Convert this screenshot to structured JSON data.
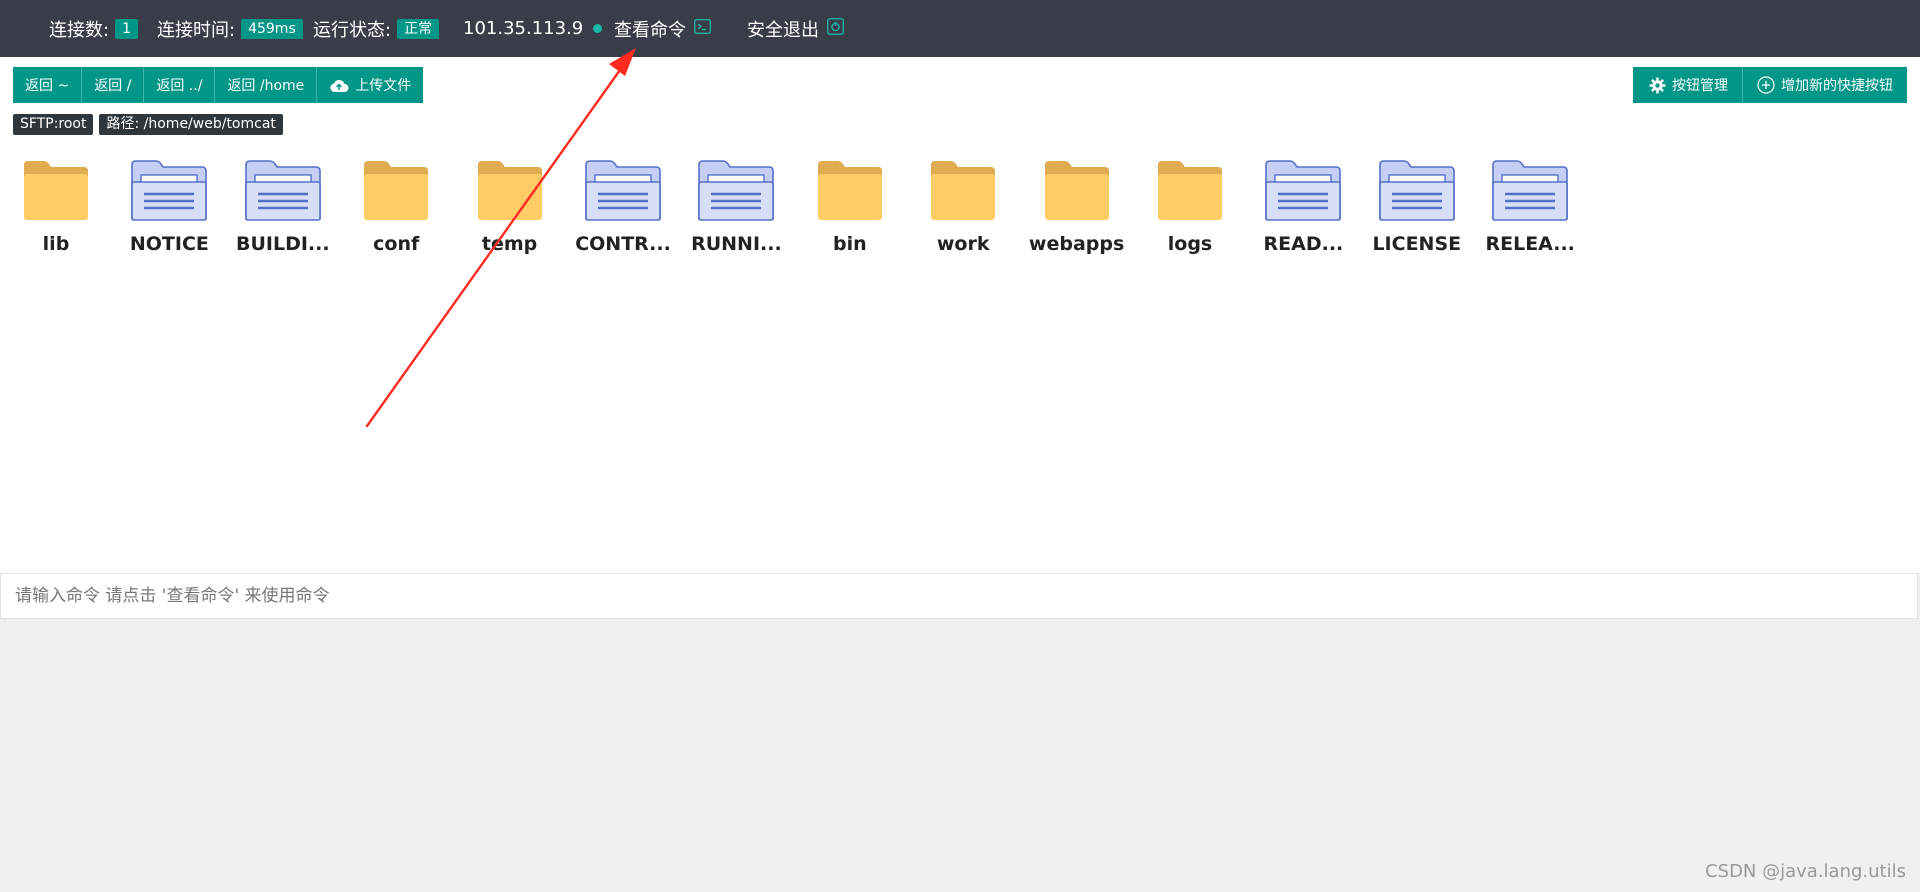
{
  "topbar": {
    "connections_label": "连接数:",
    "connections_value": "1",
    "time_label": "连接时间:",
    "time_value": "459ms",
    "status_label": "运行状态:",
    "status_value": "正常",
    "host": "101.35.113.9",
    "view_commands": "查看命令",
    "logout": "安全退出"
  },
  "toolbar": {
    "back_buttons": [
      "返回 ~",
      "返回 /",
      "返回 ../",
      "返回 /home"
    ],
    "upload": "上传文件",
    "manage_buttons": "按钮管理",
    "add_shortcut": "增加新的快捷按钮"
  },
  "tags": {
    "sftp": "SFTP:root",
    "path": "路径: /home/web/tomcat"
  },
  "files": [
    {
      "name": "lib",
      "type": "folder"
    },
    {
      "name": "NOTICE",
      "type": "file"
    },
    {
      "name": "BUILDI...",
      "type": "file"
    },
    {
      "name": "conf",
      "type": "folder"
    },
    {
      "name": "temp",
      "type": "folder"
    },
    {
      "name": "CONTR...",
      "type": "file"
    },
    {
      "name": "RUNNI...",
      "type": "file"
    },
    {
      "name": "bin",
      "type": "folder"
    },
    {
      "name": "work",
      "type": "folder"
    },
    {
      "name": "webapps",
      "type": "folder"
    },
    {
      "name": "logs",
      "type": "folder"
    },
    {
      "name": "READ...",
      "type": "file"
    },
    {
      "name": "LICENSE",
      "type": "file"
    },
    {
      "name": "RELEA...",
      "type": "file"
    }
  ],
  "command": {
    "placeholder": "请输入命令 请点击 '查看命令' 来使用命令"
  },
  "colors": {
    "topbar": "#393d49",
    "accent": "#009688",
    "annotation_arrow": "#ff2a1f"
  },
  "watermark": "CSDN @java.lang.utils"
}
